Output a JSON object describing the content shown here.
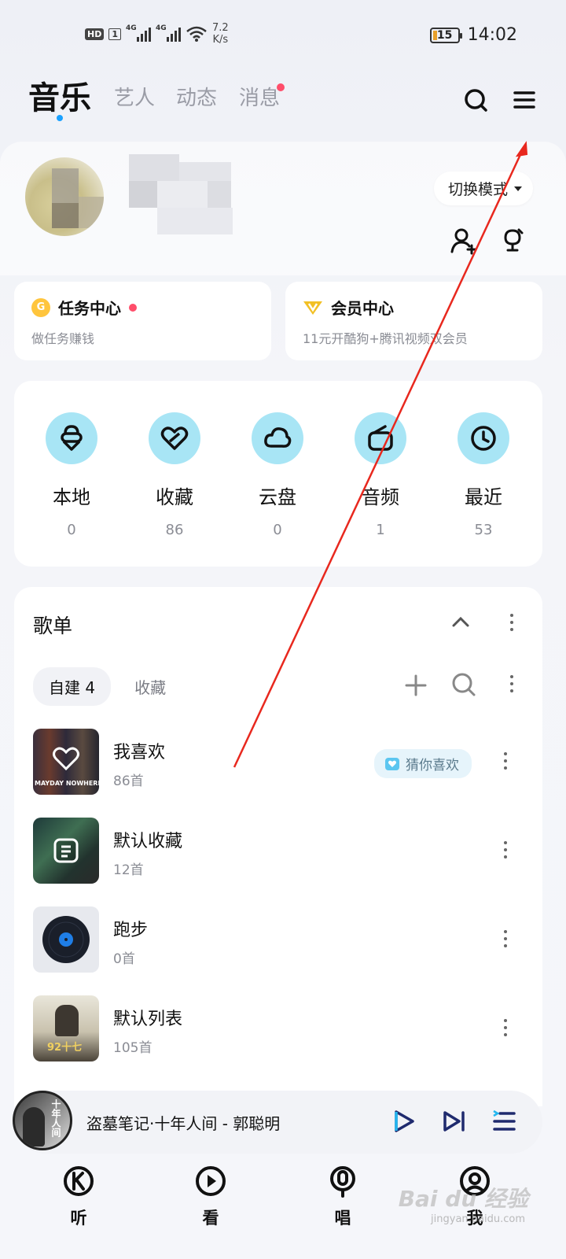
{
  "status_bar": {
    "hd": "HD",
    "sim": "1",
    "net1": "4G",
    "net2": "4G",
    "speed_value": "7.2",
    "speed_unit": "K/s",
    "battery": "15",
    "time": "14:02"
  },
  "header": {
    "tabs": [
      {
        "label": "音乐",
        "active": true
      },
      {
        "label": "艺人"
      },
      {
        "label": "动态"
      },
      {
        "label": "消息",
        "badge": true
      }
    ]
  },
  "profile": {
    "switch_mode_label": "切换模式"
  },
  "cards": {
    "task": {
      "title": "任务中心",
      "subtitle": "做任务赚钱",
      "coin": "G"
    },
    "vip": {
      "title": "会员中心",
      "subtitle": "11元开酷狗+腾讯视频双会员"
    }
  },
  "quick": [
    {
      "label": "本地",
      "count": "0",
      "icon": "bag-icon"
    },
    {
      "label": "收藏",
      "count": "86",
      "icon": "heart-icon"
    },
    {
      "label": "云盘",
      "count": "0",
      "icon": "cloud-icon"
    },
    {
      "label": "音频",
      "count": "1",
      "icon": "radio-icon"
    },
    {
      "label": "最近",
      "count": "53",
      "icon": "clock-icon"
    }
  ],
  "playlists": {
    "title": "歌单",
    "tabs": {
      "own": "自建 4",
      "fav": "收藏"
    },
    "items": [
      {
        "name": "我喜欢",
        "count": "86首",
        "cover_text": "MAYDAY NOWHERE",
        "guess": "猜你喜欢"
      },
      {
        "name": "默认收藏",
        "count": "12首"
      },
      {
        "name": "跑步",
        "count": "0首"
      },
      {
        "name": "默认列表",
        "count": "105首",
        "cover_text": "92十七"
      }
    ]
  },
  "player": {
    "title": "盗墓笔记·十年人间 - 郭聪明",
    "art_text": "十年人间"
  },
  "nav": [
    {
      "label": "听",
      "icon": "k-logo-icon"
    },
    {
      "label": "看",
      "icon": "play-circle-icon"
    },
    {
      "label": "唱",
      "icon": "mic-icon"
    },
    {
      "label": "我",
      "icon": "me-icon"
    }
  ],
  "watermark": {
    "text": "Bai du 经验",
    "sub": "jingyan.baidu.com"
  },
  "colors": {
    "accent": "#1aa1ff",
    "badge": "#ff4d6a",
    "quick_bg": "#a8e5f5",
    "annotation": "#e8281e"
  }
}
